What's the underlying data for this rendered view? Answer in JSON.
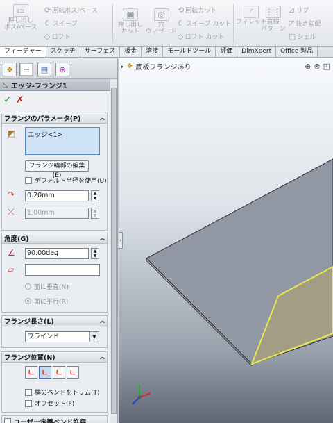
{
  "ribbon": {
    "revolve_boss": "回転ボス/ベース",
    "sweep": "スイープ",
    "loft": "ロフト",
    "extrude_cut": "押し出し\nカット",
    "hole_wizard": "穴\nウィザード",
    "revolve_cut": "回転カット",
    "sweep_cut": "スイープ カット",
    "loft_cut": "ロフト カット",
    "fillet": "フィレット",
    "linear_pattern": "直線\nパターン",
    "rib": "リブ",
    "draft": "抜き勾配",
    "shell": "シェル",
    "extrude_boss": "押し出し\nボス/ベース"
  },
  "tabs": [
    "フィーチャー",
    "スケッチ",
    "サーフェス",
    "板金",
    "溶接",
    "モールドツール",
    "評価",
    "DimXpert",
    "Office 製品"
  ],
  "panel": {
    "title": "エッジ-フランジ1",
    "ok_label": "✓",
    "cancel_label": "✗",
    "flange_params": {
      "header": "フランジのパラメータ(P)",
      "selection_item": "エッジ<1>",
      "edit_profile_button": "フランジ輪郭の編集(E)",
      "default_radius_label": "デフォルト半径を使用(U)",
      "radius_value": "0.20mm",
      "gap_value": "1.00mm"
    },
    "angle": {
      "header": "角度(G)",
      "angle_value": "90.00deg",
      "face_value": "",
      "normal_to_face": "面に垂直(N)",
      "parallel_to_face": "面に平行(R)"
    },
    "flange_length": {
      "header": "フランジ長さ(L)",
      "end_condition": "ブラインド"
    },
    "flange_position": {
      "header": "フランジ位置(N)",
      "trim_side_bends": "横のベンドをトリム(T)",
      "offset": "オフセット(F)"
    },
    "custom_bend_allowance_header": "ユーザー定義ベンド許容"
  },
  "viewport": {
    "breadcrumb": "底板フランジあり"
  },
  "colors": {
    "highlight_edge": "#e8e84a",
    "sheet_face": "#9298a3",
    "flange_face": "#a49d85",
    "ok_green": "#1b9a2b",
    "cancel_red": "#cc2020"
  }
}
